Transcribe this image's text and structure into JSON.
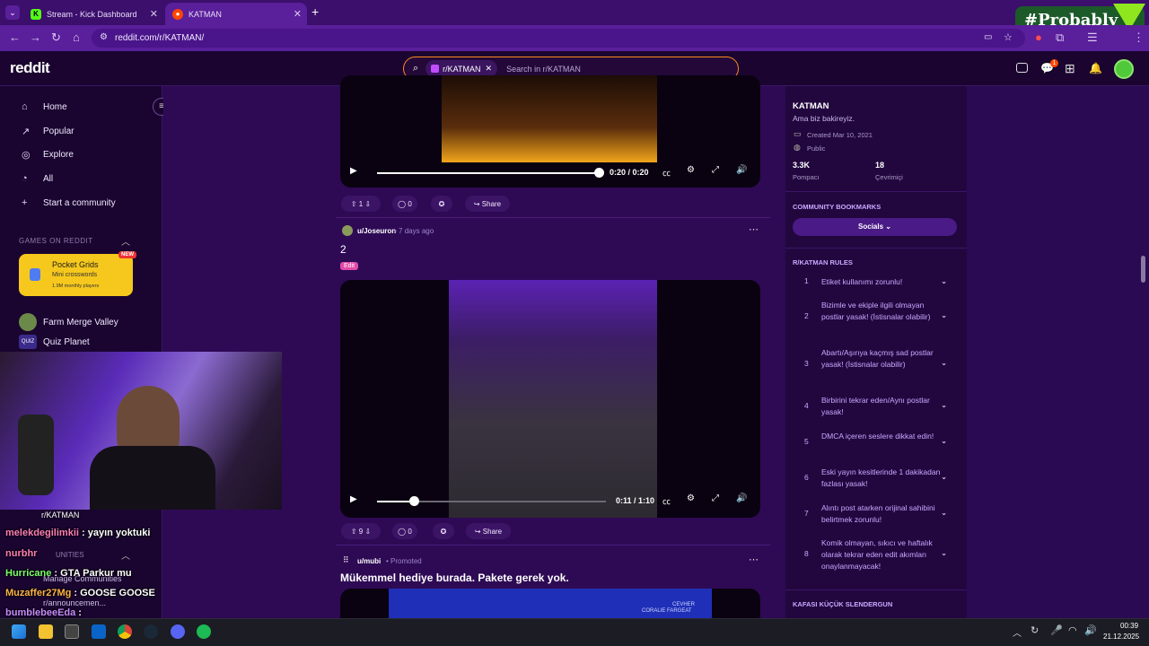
{
  "browser": {
    "tabs": [
      {
        "label": "Stream - Kick Dashboard",
        "icon": "kick-icon"
      },
      {
        "label": "KATMAN",
        "icon": "reddit-icon"
      }
    ],
    "url": "reddit.com/r/KATMAN/"
  },
  "overlay_badge": "#Probably",
  "reddit": {
    "logo": "reddit",
    "search": {
      "chip": "r/KATMAN",
      "placeholder": "Search in r/KATMAN"
    },
    "notification_count": "1"
  },
  "left_nav": {
    "items": [
      "Home",
      "Popular",
      "Explore",
      "All",
      "Start a community"
    ],
    "games_heading": "GAMES ON REDDIT",
    "featured_game": {
      "title": "Pocket Grids",
      "subtitle": "Mini crosswords",
      "players": "1.9M monthly players",
      "badge": "NEW"
    },
    "games": [
      "Farm Merge Valley",
      "Quiz Planet"
    ],
    "communities_heading": "UNITIES",
    "manage": "Manage Communities",
    "announce": "r/announcemen..."
  },
  "feed": {
    "post1": {
      "time": "0:20 / 0:20",
      "progress": 1.0,
      "votes": "1",
      "comments": "0",
      "share": "Share"
    },
    "post2": {
      "author": "u/Joseuron",
      "age": "7 days ago",
      "title": "2",
      "flair": "Edit",
      "time": "0:11 / 1:10",
      "progress": 0.157,
      "votes": "9",
      "comments": "0",
      "share": "Share"
    },
    "promo": {
      "author": "u/mubi",
      "tag": "Promoted",
      "title": "Mükemmel hediye burada. Pakete gerek yok.",
      "banner_line1": "CEVHER",
      "banner_line2": "CORALIE FARGEAT"
    }
  },
  "community": {
    "name": "KATMAN",
    "tagline": "Ama biz bakireyiz.",
    "created": "Created Mar 10, 2021",
    "visibility": "Public",
    "members": "3.3K",
    "members_label": "Pompacı",
    "online": "18",
    "online_label": "Çevrimiçi",
    "bookmarks_heading": "COMMUNITY BOOKMARKS",
    "bookmarks_button": "Socials",
    "rules_heading": "R/KATMAN RULES",
    "rules": [
      {
        "n": "1",
        "text": "Etiket kullanımı zorunlu!"
      },
      {
        "n": "2",
        "text": "Bizimle ve ekiple ilgili olmayan postlar yasak! (İstisnalar olabilir)"
      },
      {
        "n": "3",
        "text": "Abartı/Aşırıya kaçmış sad postlar yasak! (İstisnalar olabilir)"
      },
      {
        "n": "4",
        "text": "Birbirini tekrar eden/Aynı postlar yasak!"
      },
      {
        "n": "5",
        "text": "DMCA içeren seslere dikkat edin!"
      },
      {
        "n": "6",
        "text": "Eski yayın kesitlerinde 1 dakikadan fazlası yasak!"
      },
      {
        "n": "7",
        "text": "Alıntı post atarken orijinal sahibini belirtmek zorunlu!"
      },
      {
        "n": "8",
        "text": "Komik olmayan, sıkıcı ve haftalık olarak tekrar eden edit akımları onaylanmayacak!"
      }
    ],
    "flair_heading": "KAFASI KÜÇÜK SLENDERGUN"
  },
  "chat": [
    {
      "user": "melekdegilimkii",
      "msg": " : yayın yoktuki",
      "color": "#ff7eb9"
    },
    {
      "user": "nurbhr",
      "msg": "",
      "color": "#ff7eb9"
    },
    {
      "user": "Hurricane",
      "msg": " : GTA Parkur mu",
      "color": "#7dff6a"
    },
    {
      "user": "Muzaffer27Mg",
      "msg": " : GOOSE GOOSE",
      "color": "#ffb347"
    },
    {
      "user": "bumblebeeEda",
      "msg": " :",
      "color": "#c98bff"
    }
  ],
  "chat_top": "r/KATMAN",
  "taskbar": {
    "time": "00:39",
    "date": "21.12.2025"
  }
}
